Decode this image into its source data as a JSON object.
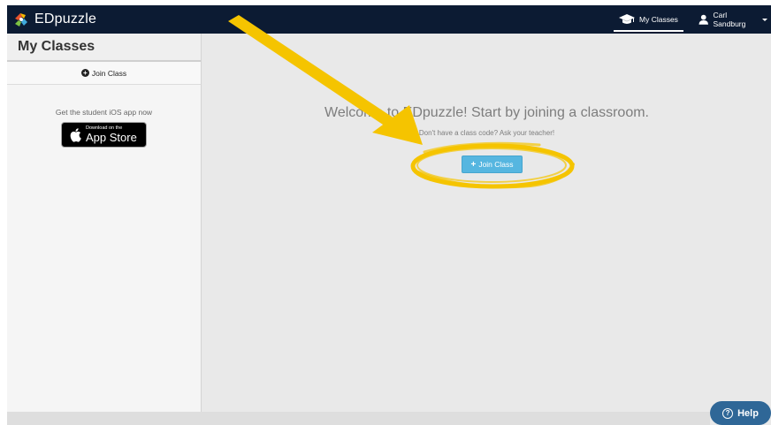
{
  "navbar": {
    "brand": "EDpuzzle",
    "my_classes": "My Classes",
    "user_name": "Carl Sandburg",
    "background": "#0c1b33"
  },
  "sidebar": {
    "title": "My Classes",
    "join_class": "Join Class",
    "ios_text": "Get the student iOS app now",
    "appstore_small": "Download on the",
    "appstore_big": "App Store"
  },
  "main": {
    "welcome": "Welcome to EDpuzzle! Start by joining a classroom.",
    "subtext": "Don't have a class code? Ask your teacher!",
    "join_button": "Join Class",
    "accent": "#56b6e0"
  },
  "annotation": {
    "color": "#f5c400",
    "icons": [
      "arrow",
      "circle-highlight"
    ]
  },
  "help": {
    "label": "Help",
    "background": "#2f6797"
  }
}
